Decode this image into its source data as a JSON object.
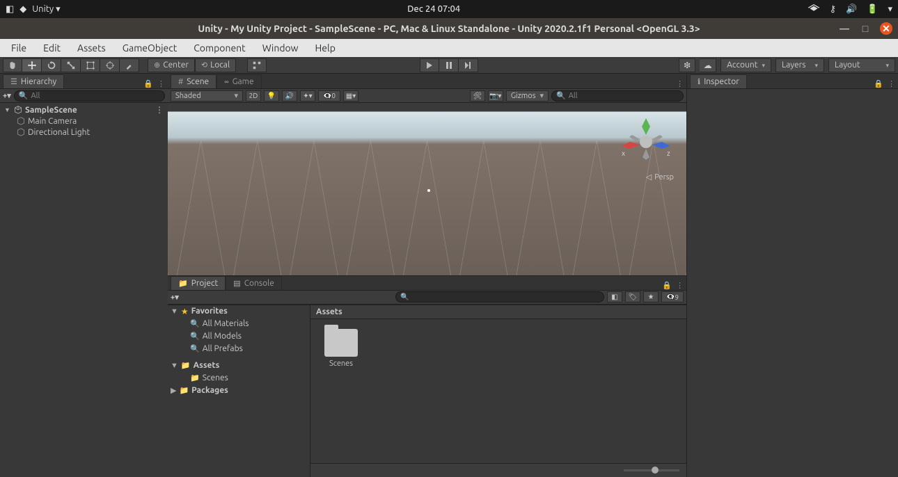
{
  "sysbar": {
    "app_label": "Unity",
    "clock": "Dec 24  07:04"
  },
  "titlebar": {
    "title": "Unity - My Unity Project - SampleScene - PC, Mac & Linux Standalone - Unity 2020.2.1f1 Personal <OpenGL 3.3>"
  },
  "menubar": [
    "File",
    "Edit",
    "Assets",
    "GameObject",
    "Component",
    "Window",
    "Help"
  ],
  "toolbar": {
    "pivot_label": "Center",
    "space_label": "Local",
    "account": "Account",
    "layers": "Layers",
    "layout": "Layout"
  },
  "hierarchy": {
    "tab": "Hierarchy",
    "search_placeholder": "All",
    "scene": "SampleScene",
    "children": [
      "Main Camera",
      "Directional Light"
    ]
  },
  "scene": {
    "tab_scene": "Scene",
    "tab_game": "Game",
    "shaded": "Shaded",
    "mode_2d": "2D",
    "fx_count": "0",
    "gizmos": "Gizmos",
    "search_placeholder": "All",
    "persp": "Persp",
    "axis_x": "x",
    "axis_z": "z"
  },
  "inspector": {
    "tab": "Inspector"
  },
  "project": {
    "tab_project": "Project",
    "tab_console": "Console",
    "hidden_count": "9",
    "favorites": "Favorites",
    "fav_items": [
      "All Materials",
      "All Models",
      "All Prefabs"
    ],
    "assets": "Assets",
    "assets_children": [
      "Scenes"
    ],
    "packages": "Packages",
    "breadcrumb": "Assets",
    "grid_items": [
      {
        "name": "Scenes",
        "type": "folder"
      }
    ]
  }
}
